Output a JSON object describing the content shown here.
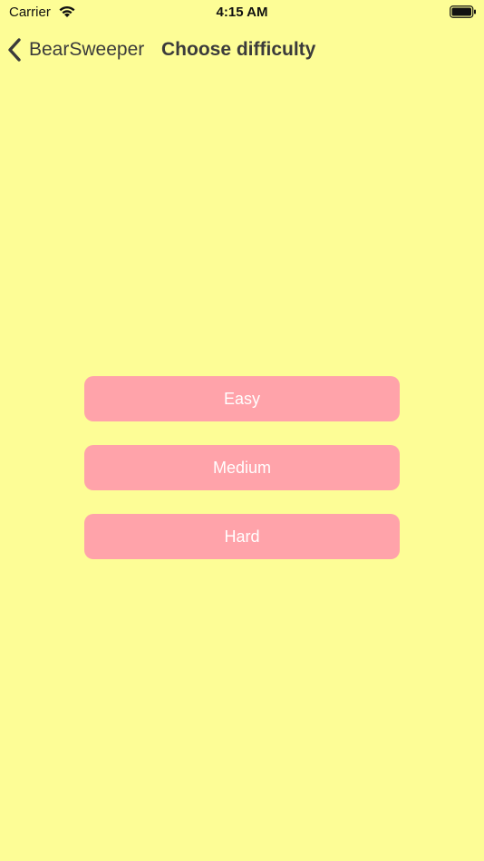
{
  "status_bar": {
    "carrier": "Carrier",
    "time": "4:15 AM",
    "wifi_icon": "wifi-icon",
    "battery_icon": "battery-icon"
  },
  "nav": {
    "back_label": "BearSweeper",
    "back_icon": "chevron-left-icon",
    "title": "Choose difficulty"
  },
  "difficulties": [
    {
      "label": "Easy"
    },
    {
      "label": "Medium"
    },
    {
      "label": "Hard"
    }
  ],
  "colors": {
    "background": "#fdfd96",
    "button": "#ffa3aa",
    "button_text": "#ffffff",
    "text": "#3b3b3b"
  }
}
